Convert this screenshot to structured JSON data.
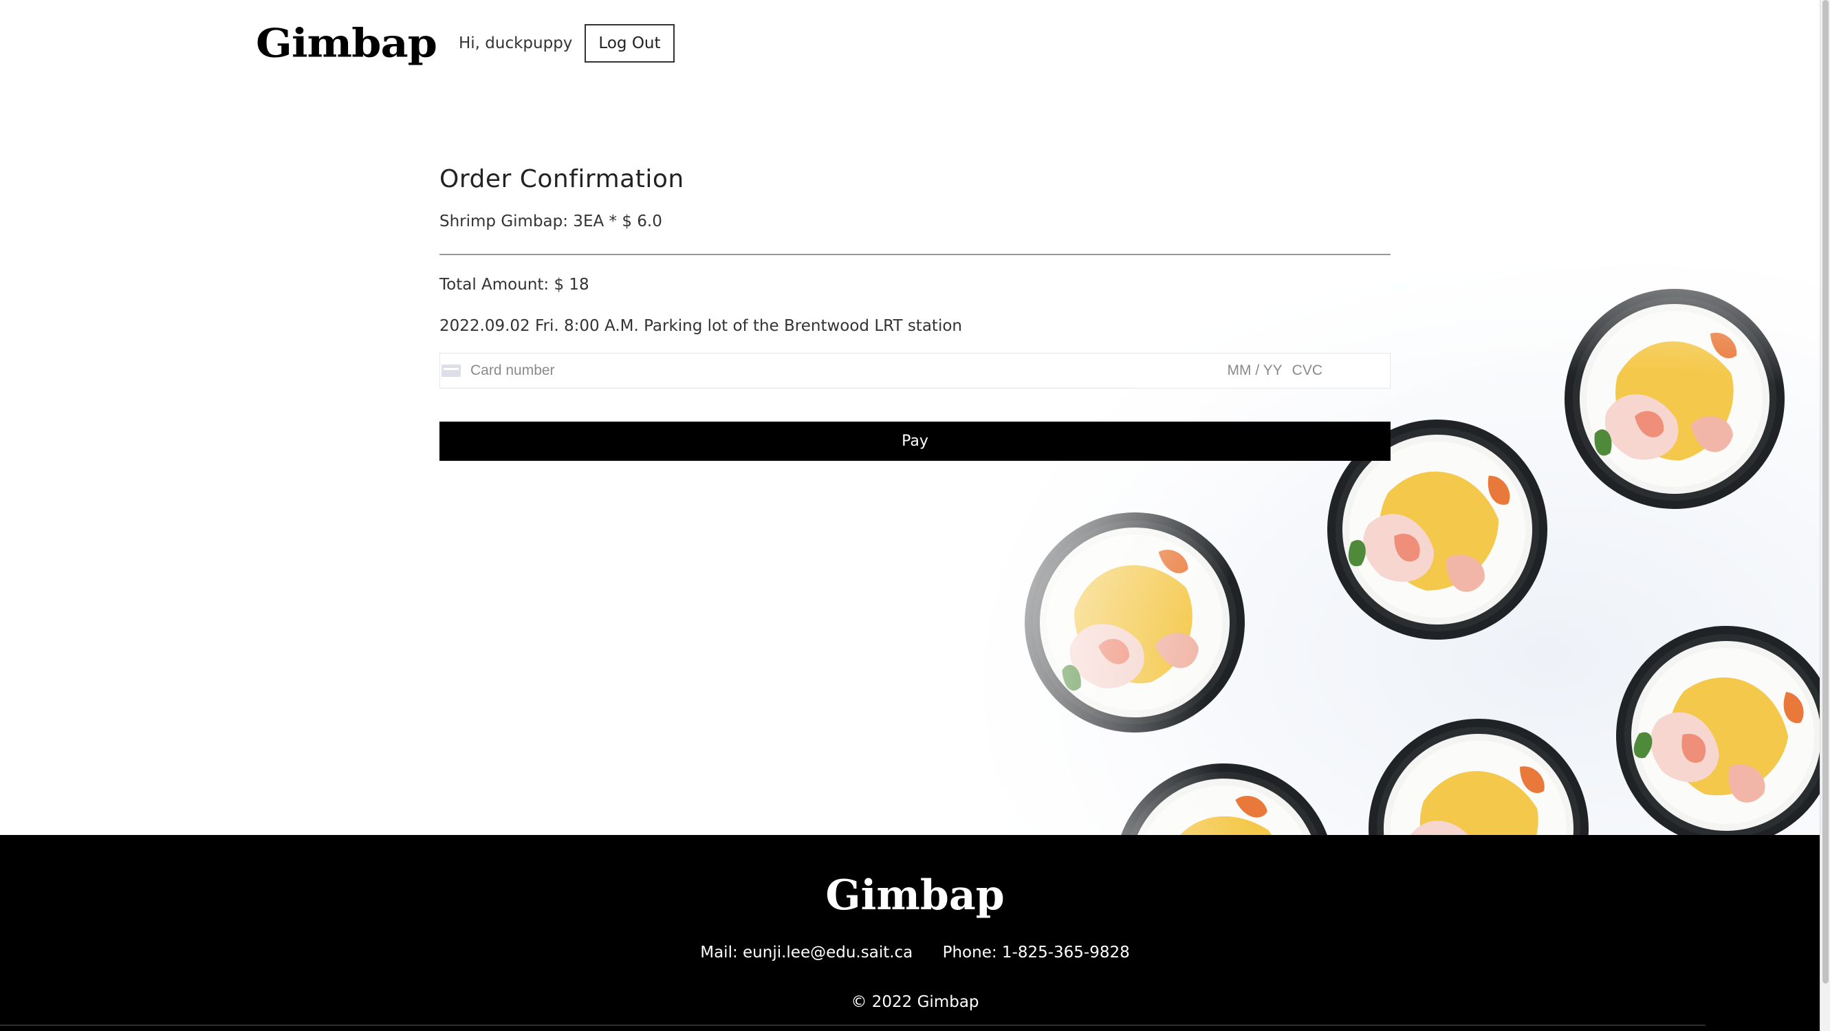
{
  "header": {
    "logo": "Gimbap",
    "greeting": "Hi, duckpuppy",
    "logout_label": "Log Out"
  },
  "order": {
    "title": "Order Confirmation",
    "item_line": "Shrimp Gimbap: 3EA * $ 6.0",
    "total_line": "Total Amount: $ 18",
    "pickup_line": "2022.09.02 Fri. 8:00 A.M. Parking lot of the Brentwood LRT station"
  },
  "payment": {
    "card_number_placeholder": "Card number",
    "exp_placeholder": "MM / YY",
    "cvc_placeholder": "CVC",
    "pay_label": "Pay"
  },
  "footer": {
    "logo": "Gimbap",
    "mail": "Mail: eunji.lee@edu.sait.ca",
    "phone": "Phone: 1-825-365-9828",
    "copyright": "© 2022 Gimbap"
  }
}
